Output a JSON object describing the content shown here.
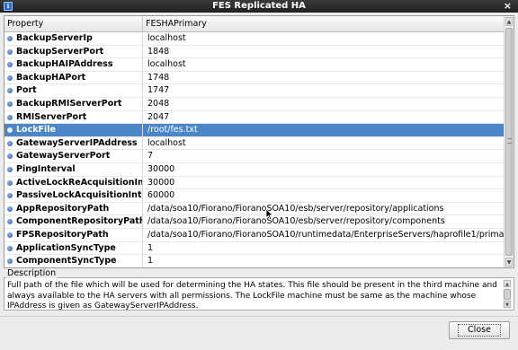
{
  "window": {
    "title": "FES Replicated HA",
    "icon": "app-icon",
    "close_icon": "×"
  },
  "table": {
    "headers": [
      "Property",
      "FESHAPrimary"
    ],
    "rows": [
      {
        "property": "BackupServerIp",
        "value": "localhost",
        "selected": false
      },
      {
        "property": "BackupServerPort",
        "value": "1848",
        "selected": false
      },
      {
        "property": "BackupHAIPAddress",
        "value": "localhost",
        "selected": false
      },
      {
        "property": "BackupHAPort",
        "value": "1748",
        "selected": false
      },
      {
        "property": "Port",
        "value": "1747",
        "selected": false
      },
      {
        "property": "BackupRMIServerPort",
        "value": "2048",
        "selected": false
      },
      {
        "property": "RMIServerPort",
        "value": "2047",
        "selected": false
      },
      {
        "property": "LockFile",
        "value": "/root/fes.txt",
        "selected": true
      },
      {
        "property": "GatewayServerIPAddress",
        "value": "localhost",
        "selected": false
      },
      {
        "property": "GatewayServerPort",
        "value": "7",
        "selected": false
      },
      {
        "property": "PingInterval",
        "value": "30000",
        "selected": false
      },
      {
        "property": "ActiveLockReAcquisitionInte",
        "value": "30000",
        "selected": false
      },
      {
        "property": "PassiveLockAcquisitionInter",
        "value": "60000",
        "selected": false
      },
      {
        "property": "AppRepositoryPath",
        "value": "/data/soa10/Fiorano/FioranoSOA10/esb/server/repository/applications",
        "selected": false
      },
      {
        "property": "ComponentRepositoryPath",
        "value": "/data/soa10/Fiorano/FioranoSOA10/esb/server/repository/components",
        "selected": false
      },
      {
        "property": "FPSRepositoryPath",
        "value": "/data/soa10/Fiorano/FioranoSOA10/runtimedata/EnterpriseServers/haprofile1/primary/FES/pe",
        "selected": false
      },
      {
        "property": "ApplicationSyncType",
        "value": "1",
        "selected": false
      },
      {
        "property": "ComponentSyncType",
        "value": "1",
        "selected": false
      }
    ]
  },
  "description": {
    "label": "Description",
    "text": "Full path of the file which will be used for determining the HA states. This file should be present in the third machine and always available to the HA servers with all permissions. The LockFile machine must be same as the machine whose IPAddress is given as GatewayServerIPAddress."
  },
  "buttons": {
    "close_label": "Close"
  },
  "colors": {
    "title_bar": "#2a2a2a",
    "selection": "#4a86c8",
    "bullet": "#2c55b7",
    "background": "#ececec"
  }
}
